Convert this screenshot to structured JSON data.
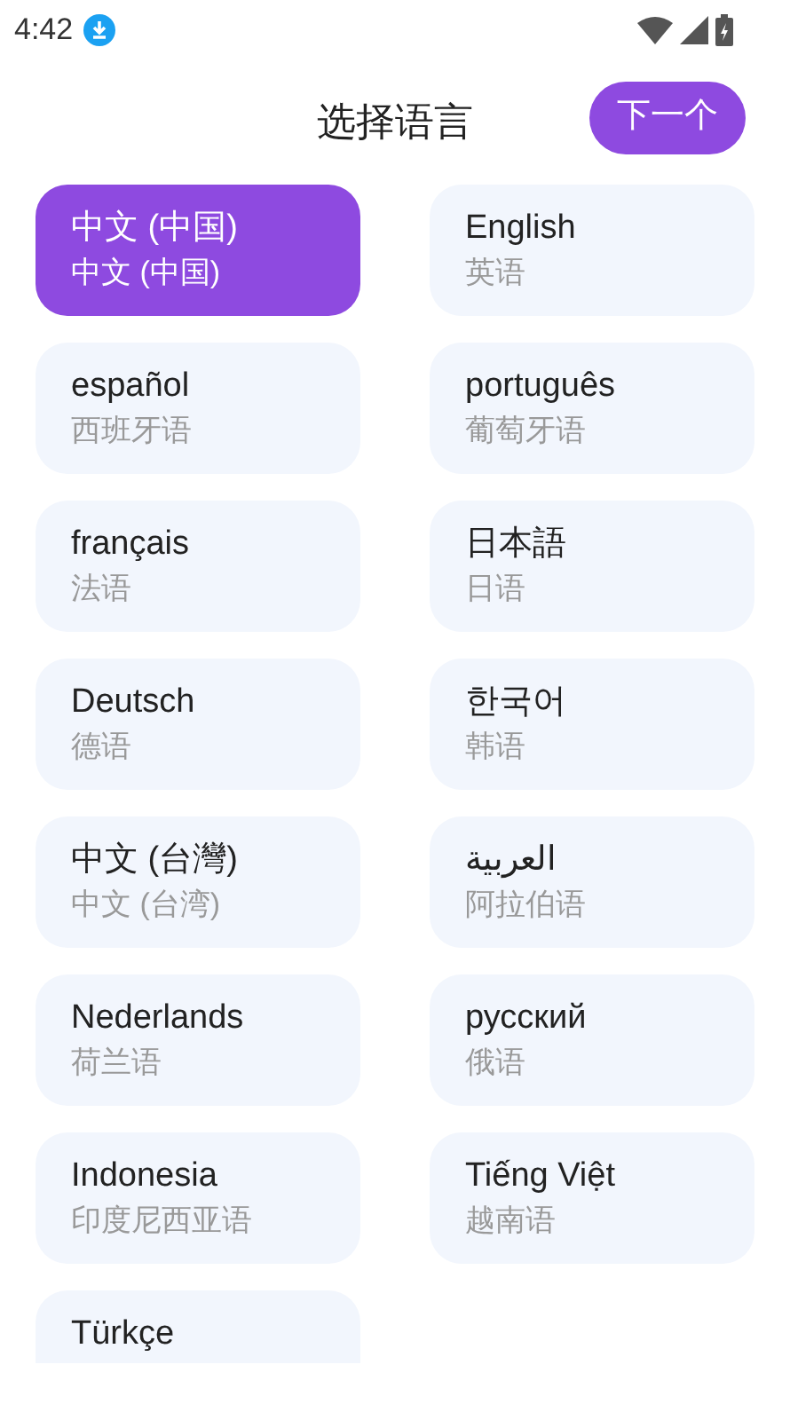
{
  "status_bar": {
    "time": "4:42"
  },
  "header": {
    "title": "选择语言",
    "next_button": "下一个"
  },
  "languages": [
    {
      "name": "中文 (中国)",
      "translation": "中文 (中国)",
      "selected": true
    },
    {
      "name": "English",
      "translation": "英语",
      "selected": false
    },
    {
      "name": "español",
      "translation": "西班牙语",
      "selected": false
    },
    {
      "name": "português",
      "translation": "葡萄牙语",
      "selected": false
    },
    {
      "name": "français",
      "translation": "法语",
      "selected": false
    },
    {
      "name": "日本語",
      "translation": "日语",
      "selected": false
    },
    {
      "name": "Deutsch",
      "translation": "德语",
      "selected": false
    },
    {
      "name": "한국어",
      "translation": "韩语",
      "selected": false
    },
    {
      "name": "中文 (台灣)",
      "translation": "中文 (台湾)",
      "selected": false
    },
    {
      "name": "العربية",
      "translation": "阿拉伯语",
      "selected": false
    },
    {
      "name": "Nederlands",
      "translation": "荷兰语",
      "selected": false
    },
    {
      "name": "русский",
      "translation": "俄语",
      "selected": false
    },
    {
      "name": "Indonesia",
      "translation": "印度尼西亚语",
      "selected": false
    },
    {
      "name": "Tiếng Việt",
      "translation": "越南语",
      "selected": false
    },
    {
      "name": "Türkçe",
      "selected": false
    }
  ]
}
